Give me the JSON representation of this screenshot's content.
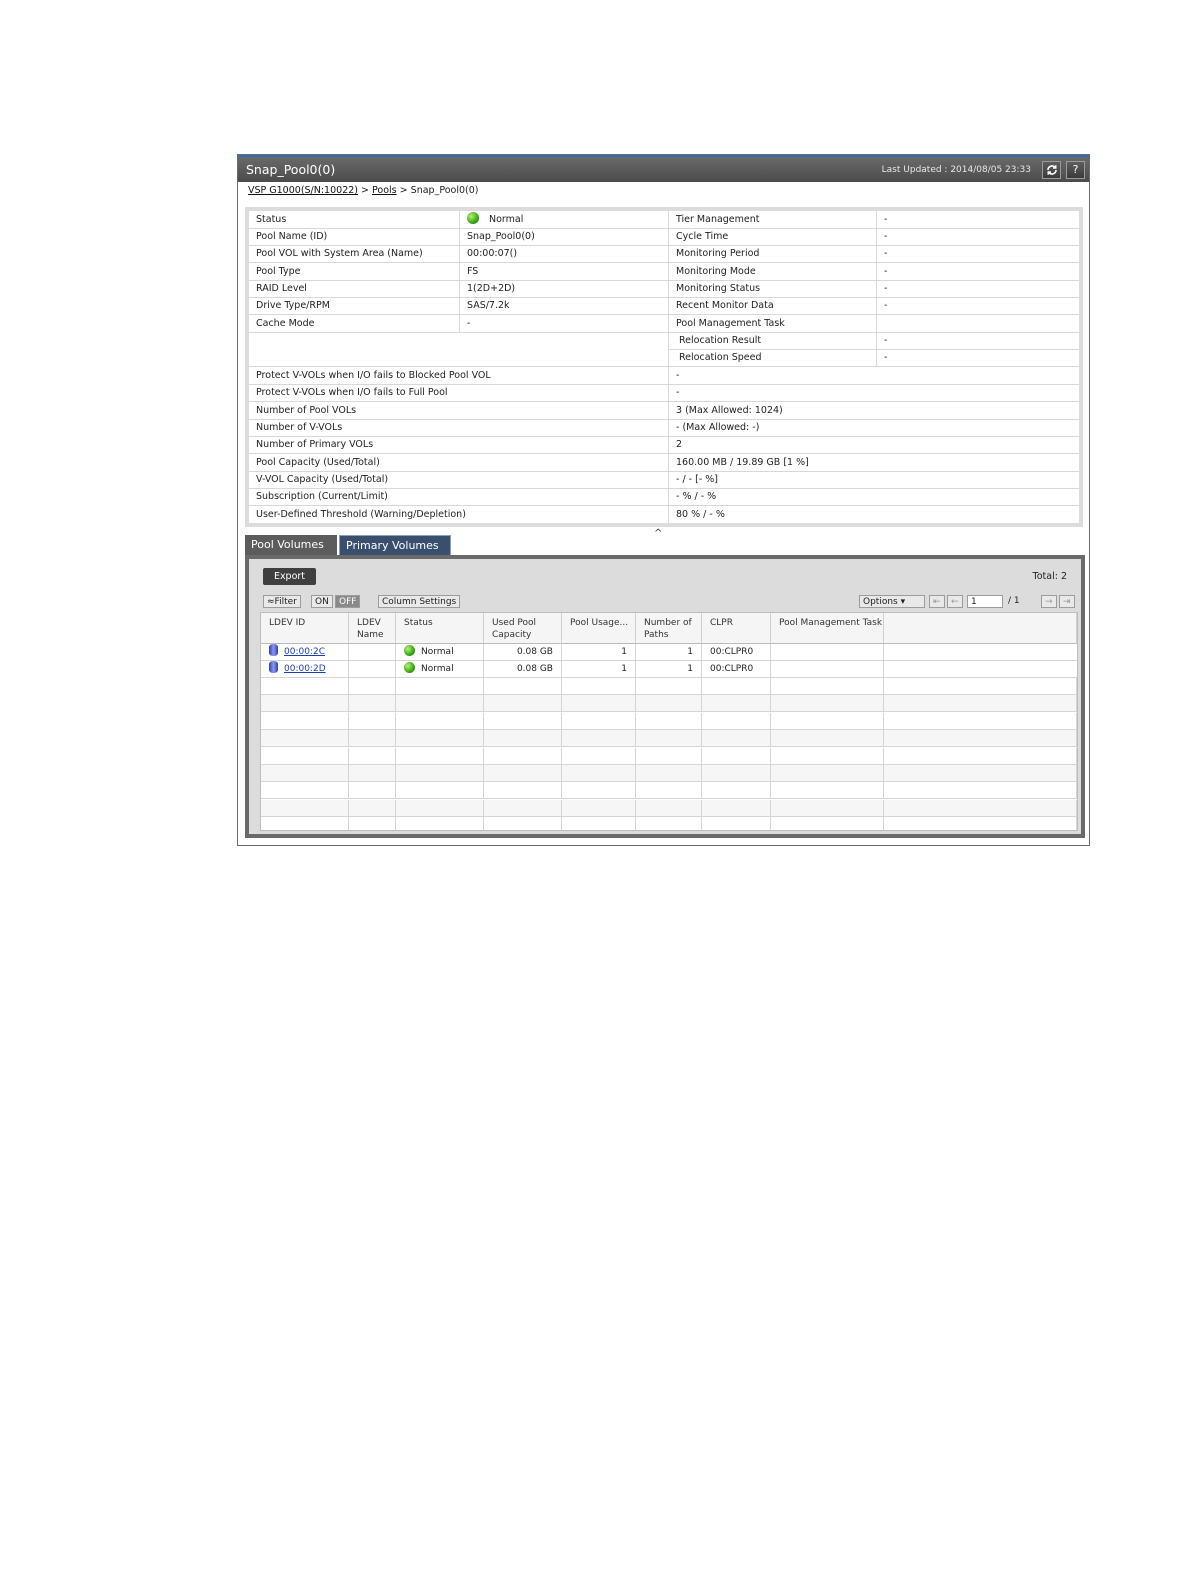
{
  "window": {
    "title": "Snap_Pool0(0)",
    "last_updated": "Last Updated : 2014/08/05 23:33",
    "refresh_icon": "refresh-icon",
    "help_label": "?"
  },
  "breadcrumb": {
    "storage": "VSP G1000(S/N:10022)",
    "sep1": ">",
    "pools": "Pools",
    "sep2": ">",
    "current": "Snap_Pool0(0)"
  },
  "properties": {
    "left": [
      {
        "label": "Status",
        "value": "Normal"
      },
      {
        "label": "Pool Name (ID)",
        "value": "Snap_Pool0(0)"
      },
      {
        "label": "Pool VOL with System Area (Name)",
        "value": "00:00:07()"
      },
      {
        "label": "Pool Type",
        "value": "FS"
      },
      {
        "label": "RAID Level",
        "value": "1(2D+2D)"
      },
      {
        "label": "Drive Type/RPM",
        "value": "SAS/7.2k"
      },
      {
        "label": "Cache Mode",
        "value": "-"
      }
    ],
    "right": [
      {
        "label": "Tier Management",
        "value": "-"
      },
      {
        "label": "Cycle Time",
        "value": "-"
      },
      {
        "label": "Monitoring Period",
        "value": "-"
      },
      {
        "label": "Monitoring Mode",
        "value": "-"
      },
      {
        "label": "Monitoring Status",
        "value": "-"
      },
      {
        "label": "Recent Monitor Data",
        "value": "-"
      },
      {
        "label": "Pool Management Task",
        "value": ""
      },
      {
        "label": "Relocation Result",
        "value": "-"
      },
      {
        "label": "Relocation Speed",
        "value": "-"
      }
    ],
    "full": [
      {
        "label": "Protect V-VOLs when I/O fails to Blocked Pool VOL",
        "value": "-"
      },
      {
        "label": "Protect V-VOLs when I/O fails to Full Pool",
        "value": "-"
      },
      {
        "label": "Number of Pool VOLs",
        "value": "3 (Max Allowed: 1024)"
      },
      {
        "label": "Number of V-VOLs",
        "value": "- (Max Allowed: -)"
      },
      {
        "label": "Number of Primary VOLs",
        "value": "2"
      },
      {
        "label": "Pool Capacity (Used/Total)",
        "value": "160.00 MB / 19.89 GB [1 %]"
      },
      {
        "label": "V-VOL Capacity (Used/Total)",
        "value": "- / - [- %]"
      },
      {
        "label": "Subscription (Current/Limit)",
        "value": "- % / - %"
      },
      {
        "label": "User-Defined Threshold (Warning/Depletion)",
        "value": "80 % / - %"
      }
    ],
    "collapse_icon": "^"
  },
  "tabs": [
    {
      "label": "Pool Volumes",
      "active": false
    },
    {
      "label": "Primary Volumes",
      "active": true
    }
  ],
  "toolbar": {
    "export": "Export",
    "total": "Total:  2",
    "filter": "Filter",
    "on": "ON",
    "off": "OFF",
    "column_settings": "Column Settings",
    "options": "Options",
    "page": "1",
    "page_total": "/ 1"
  },
  "table": {
    "headers": [
      "LDEV ID",
      "LDEV Name",
      "Status",
      "Used Pool Capacity",
      "Pool Usage...",
      "Number of Paths",
      "CLPR",
      "Pool Management Task"
    ],
    "rows": [
      {
        "ldev_id": "00:00:2C",
        "name": "",
        "status": "Normal",
        "used": "0.08 GB",
        "usage": "1",
        "paths": "1",
        "clpr": "00:CLPR0",
        "task": ""
      },
      {
        "ldev_id": "00:00:2D",
        "name": "",
        "status": "Normal",
        "used": "0.08 GB",
        "usage": "1",
        "paths": "1",
        "clpr": "00:CLPR0",
        "task": ""
      }
    ]
  },
  "colors": {
    "titlebar": "#555555",
    "accent": "#2d6fb3",
    "status_normal": "#34a80e",
    "link": "#1b3fb8"
  }
}
